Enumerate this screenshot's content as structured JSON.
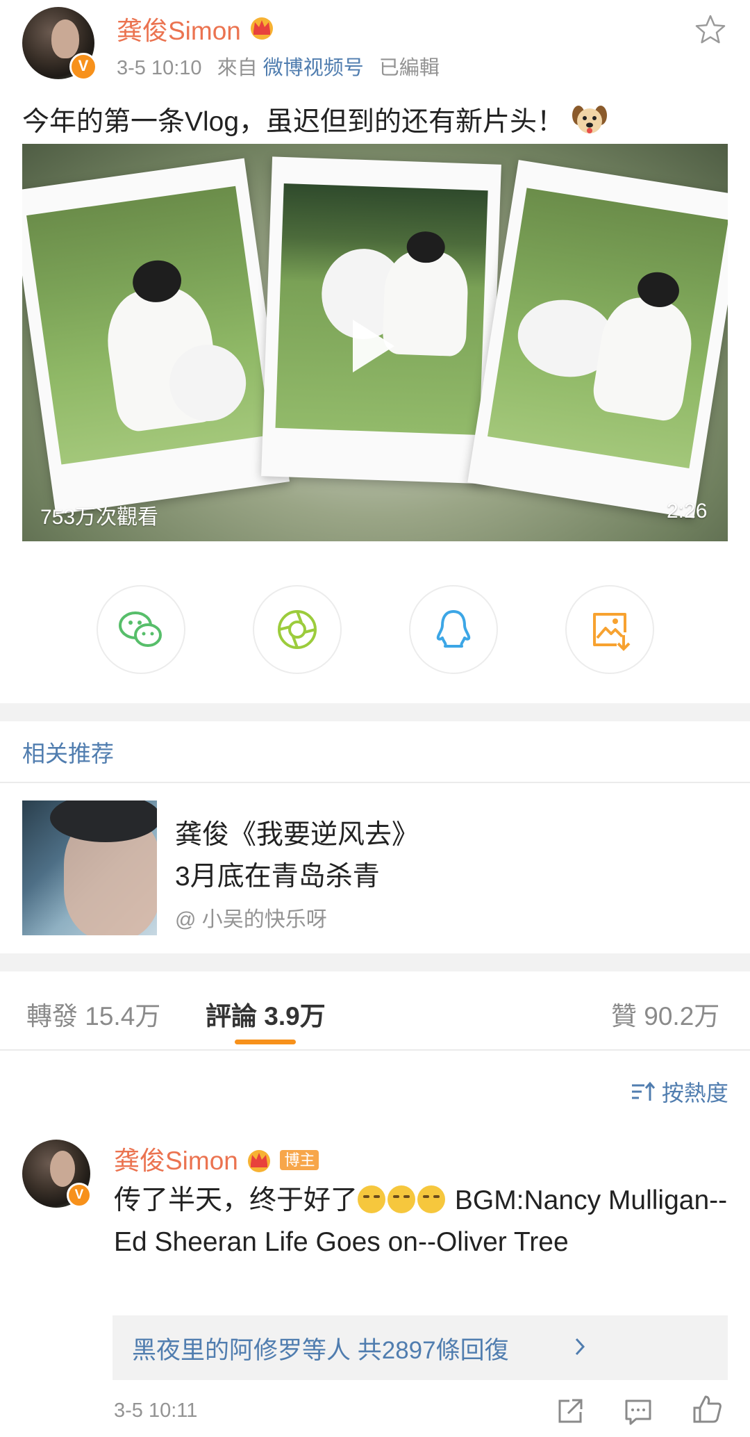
{
  "post": {
    "author": "龚俊Simon",
    "verified": "V",
    "time": "3-5 10:10",
    "source_prefix": "來自",
    "source": "微博视频号",
    "edited": "已編輯",
    "text": "今年的第一条Vlog，虽迟但到的还有新片头！",
    "text_emoji": "dog-face-emoji",
    "favorite_icon": "star-outline-icon"
  },
  "video": {
    "views": "753万次觀看",
    "duration": "2:26",
    "play_icon": "play-icon"
  },
  "share": [
    {
      "name": "wechat",
      "icon": "wechat-icon",
      "color": "#57be6a"
    },
    {
      "name": "moments",
      "icon": "wechat-moments-icon",
      "color": "#9ccc3c"
    },
    {
      "name": "qq",
      "icon": "qq-penguin-icon",
      "color": "#3ca6e6"
    },
    {
      "name": "save-image",
      "icon": "save-image-icon",
      "color": "#f7a230"
    }
  ],
  "related": {
    "header": "相关推荐",
    "item": {
      "line1": "龚俊《我要逆风去》",
      "line2": "3月底在青岛杀青",
      "author": "@ 小吴的快乐呀"
    }
  },
  "tabs": {
    "repost": "轉發 15.4万",
    "comments": "評論 3.9万",
    "likes": "贊 90.2万"
  },
  "sort_label": "按熱度",
  "comment": {
    "name": "龚俊Simon",
    "badge": "博主",
    "verified": "V",
    "text_before_emoji": "传了半天，终于好了",
    "emojis": [
      "laugh-cry",
      "laugh-cry",
      "laugh-cry"
    ],
    "text_after_emoji": " BGM:Nancy Mulligan--Ed Sheeran Life Goes on--Oliver Tree",
    "replies_link": "黑夜里的阿修罗等人 共2897條回復",
    "time": "3-5 10:11"
  },
  "colors": {
    "accent": "#f7911b",
    "link": "#507daf",
    "username": "#eb7350"
  }
}
